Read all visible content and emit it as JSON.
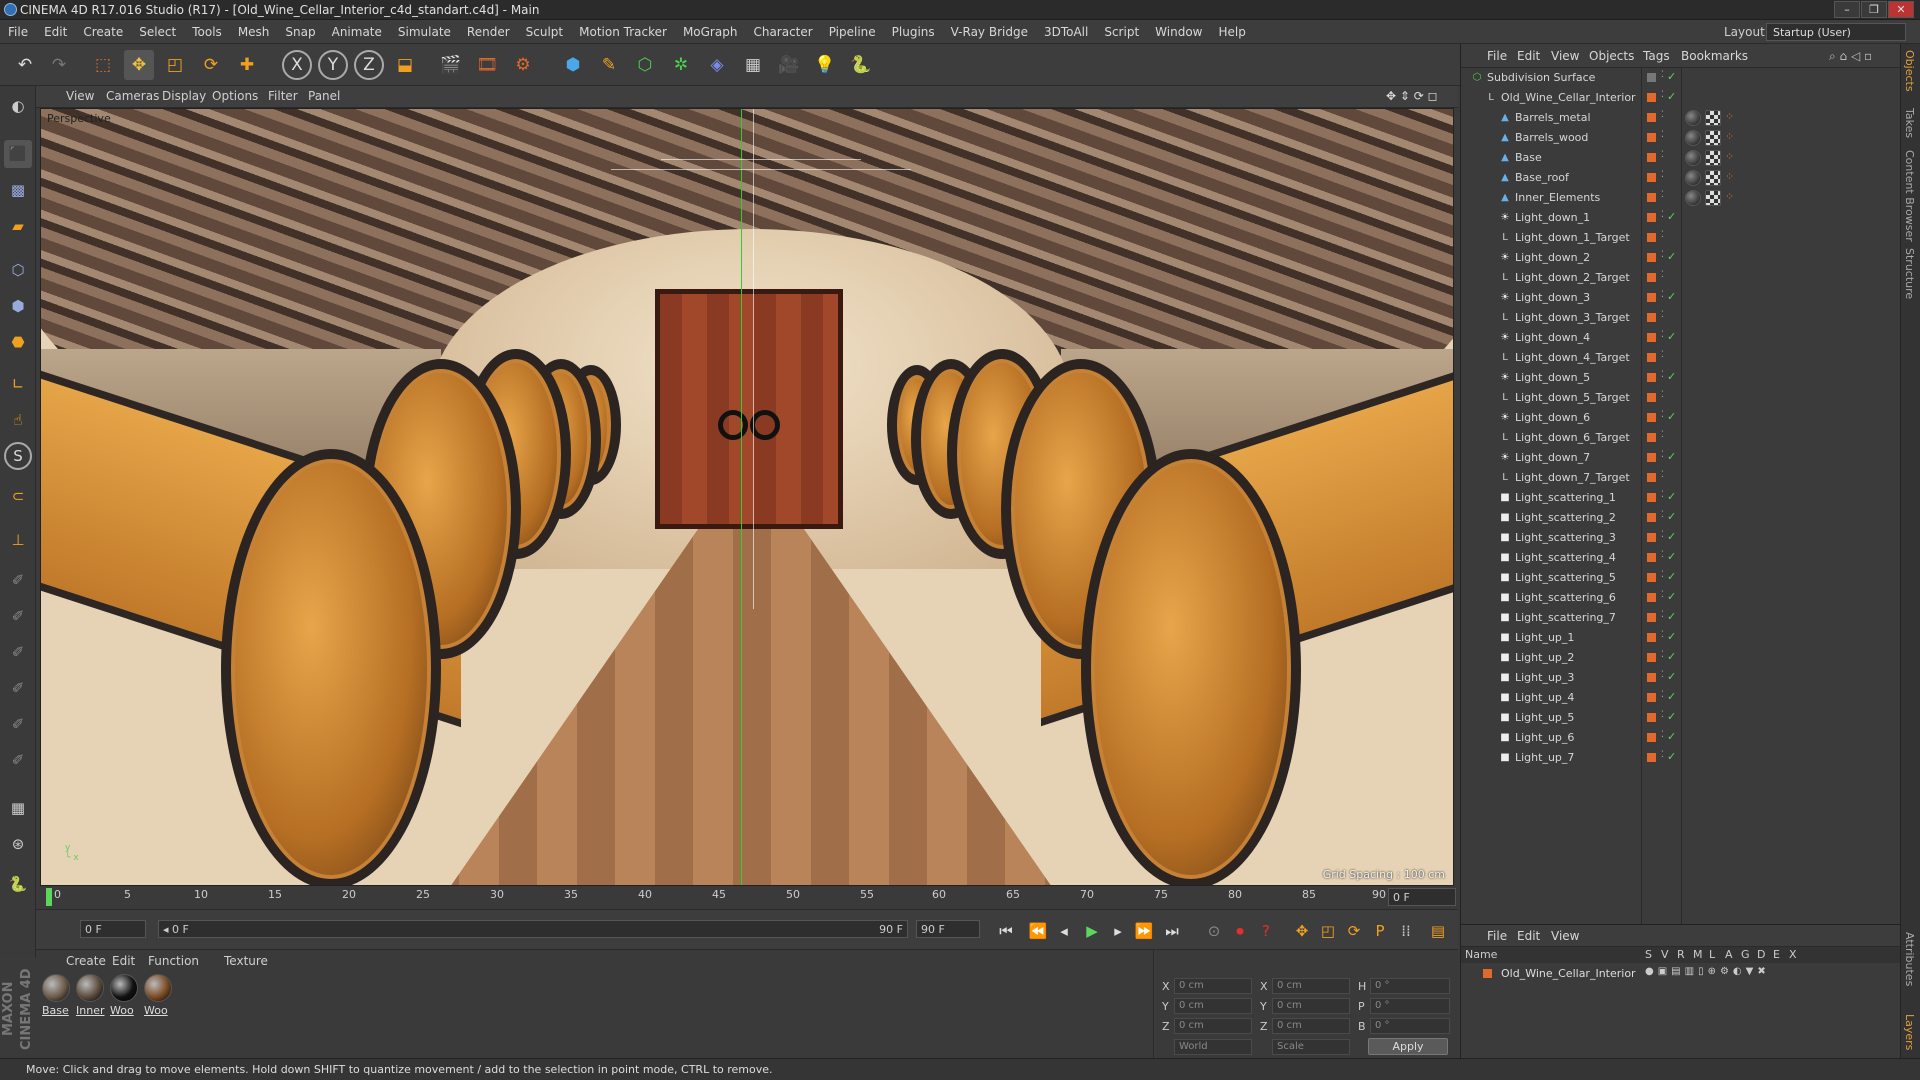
{
  "window": {
    "title": "CINEMA 4D R17.016 Studio (R17) - [Old_Wine_Cellar_Interior_c4d_standart.c4d] - Main",
    "minimize": "–",
    "restore": "❐",
    "close": "✕"
  },
  "menubar": [
    "File",
    "Edit",
    "Create",
    "Select",
    "Tools",
    "Mesh",
    "Snap",
    "Animate",
    "Simulate",
    "Render",
    "Sculpt",
    "Motion Tracker",
    "MoGraph",
    "Character",
    "Pipeline",
    "Plugins",
    "V-Ray Bridge",
    "3DToAll",
    "Script",
    "Window",
    "Help"
  ],
  "layout": {
    "label": "Layout:",
    "value": "Startup (User)"
  },
  "viewport": {
    "menu": [
      "View",
      "Cameras",
      "Display",
      "Options",
      "Filter",
      "Panel"
    ],
    "camera": "Perspective",
    "grid_spacing": "Grid Spacing : 100 cm"
  },
  "timeline": {
    "ticks": [
      "0",
      "5",
      "10",
      "15",
      "20",
      "25",
      "30",
      "35",
      "40",
      "45",
      "50",
      "55",
      "60",
      "65",
      "70",
      "75",
      "80",
      "85",
      "90"
    ],
    "current": "0 F"
  },
  "transport": {
    "start_frame": "0 F",
    "range_start": "0 F",
    "range_end": "90 F",
    "end_frame": "90 F"
  },
  "materials": {
    "menu": [
      "Create",
      "Edit",
      "Function",
      "Texture"
    ],
    "items": [
      {
        "name": "Base",
        "color": "#6b5a49"
      },
      {
        "name": "Inner",
        "color": "#5a4a3c"
      },
      {
        "name": "Woo",
        "color": "#111111"
      },
      {
        "name": "Woo",
        "color": "#7a4a24"
      }
    ]
  },
  "coordinates": {
    "x_label": "X",
    "y_label": "Y",
    "z_label": "Z",
    "h_label": "H",
    "p_label": "P",
    "b_label": "B",
    "pos_x": "0 cm",
    "pos_y": "0 cm",
    "pos_z": "0 cm",
    "size_x": "0 cm",
    "size_y": "0 cm",
    "size_z": "0 cm",
    "rot_h": "0 °",
    "rot_p": "0 °",
    "rot_b": "0 °",
    "mode": "World",
    "scale_mode": "Scale",
    "apply": "Apply"
  },
  "objects": {
    "menu": [
      "File",
      "Edit",
      "View",
      "Objects",
      "Tags",
      "Bookmarks"
    ],
    "items": [
      {
        "name": "Subdivision Surface",
        "indent": 0
      },
      {
        "name": "Old_Wine_Cellar_Interior",
        "indent": 1
      },
      {
        "name": "Barrels_metal",
        "indent": 2
      },
      {
        "name": "Barrels_wood",
        "indent": 2
      },
      {
        "name": "Base",
        "indent": 2
      },
      {
        "name": "Base_roof",
        "indent": 2
      },
      {
        "name": "Inner_Elements",
        "indent": 2
      },
      {
        "name": "Light_down_1",
        "indent": 2
      },
      {
        "name": "Light_down_1_Target",
        "indent": 2
      },
      {
        "name": "Light_down_2",
        "indent": 2
      },
      {
        "name": "Light_down_2_Target",
        "indent": 2
      },
      {
        "name": "Light_down_3",
        "indent": 2
      },
      {
        "name": "Light_down_3_Target",
        "indent": 2
      },
      {
        "name": "Light_down_4",
        "indent": 2
      },
      {
        "name": "Light_down_4_Target",
        "indent": 2
      },
      {
        "name": "Light_down_5",
        "indent": 2
      },
      {
        "name": "Light_down_5_Target",
        "indent": 2
      },
      {
        "name": "Light_down_6",
        "indent": 2
      },
      {
        "name": "Light_down_6_Target",
        "indent": 2
      },
      {
        "name": "Light_down_7",
        "indent": 2
      },
      {
        "name": "Light_down_7_Target",
        "indent": 2
      },
      {
        "name": "Light_scattering_1",
        "indent": 2
      },
      {
        "name": "Light_scattering_2",
        "indent": 2
      },
      {
        "name": "Light_scattering_3",
        "indent": 2
      },
      {
        "name": "Light_scattering_4",
        "indent": 2
      },
      {
        "name": "Light_scattering_5",
        "indent": 2
      },
      {
        "name": "Light_scattering_6",
        "indent": 2
      },
      {
        "name": "Light_scattering_7",
        "indent": 2
      },
      {
        "name": "Light_up_1",
        "indent": 2
      },
      {
        "name": "Light_up_2",
        "indent": 2
      },
      {
        "name": "Light_up_3",
        "indent": 2
      },
      {
        "name": "Light_up_4",
        "indent": 2
      },
      {
        "name": "Light_up_5",
        "indent": 2
      },
      {
        "name": "Light_up_6",
        "indent": 2
      },
      {
        "name": "Light_up_7",
        "indent": 2
      }
    ]
  },
  "layers": {
    "menu": [
      "File",
      "Edit",
      "View"
    ],
    "columns": [
      "Name",
      "S",
      "V",
      "R",
      "M",
      "L",
      "A",
      "G",
      "D",
      "E",
      "X"
    ],
    "row": "Old_Wine_Cellar_Interior"
  },
  "side_tabs": [
    "Objects",
    "Takes",
    "Content Browser",
    "Structure",
    "Attributes",
    "Layers"
  ],
  "status": "Move: Click and drag to move elements. Hold down SHIFT to quantize movement / add to the selection in point mode, CTRL to remove.",
  "brand": "MAXON CINEMA 4D",
  "colors": {
    "accent": "#e06a2c",
    "check": "#66cc66"
  }
}
